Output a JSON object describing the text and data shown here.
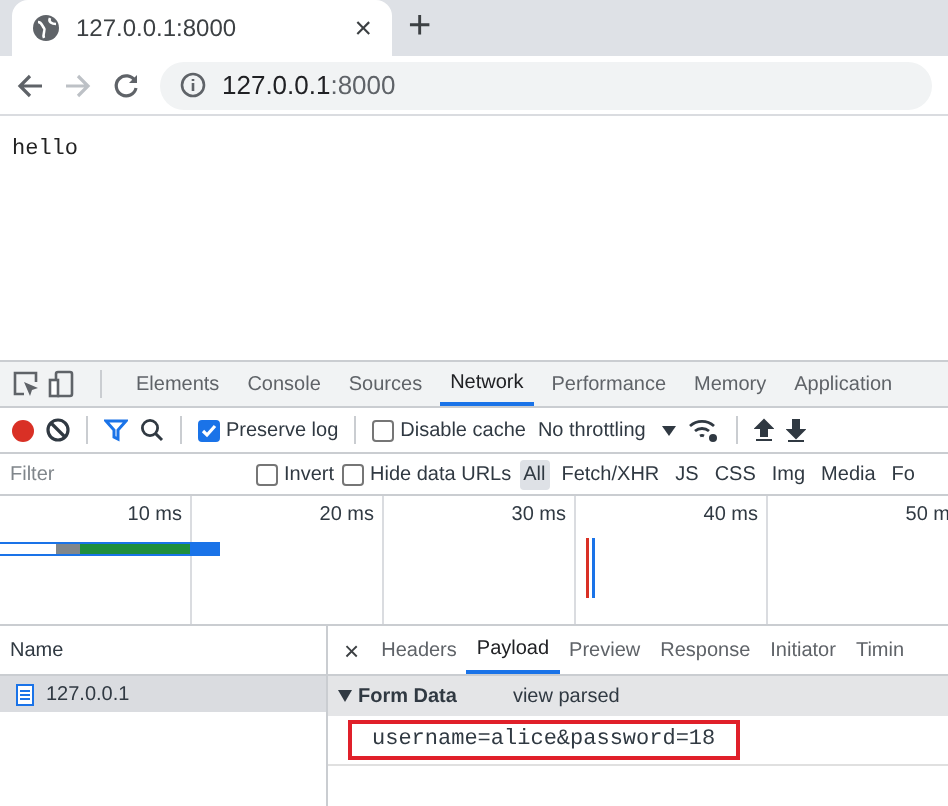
{
  "browser_tab": {
    "title": "127.0.0.1:8000",
    "close": "×",
    "new_tab": "+"
  },
  "address_bar": {
    "host": "127.0.0.1",
    "port": ":8000"
  },
  "page": {
    "text": "hello"
  },
  "devtools": {
    "tabs": [
      {
        "label": "Elements",
        "selected": false
      },
      {
        "label": "Console",
        "selected": false
      },
      {
        "label": "Sources",
        "selected": false
      },
      {
        "label": "Network",
        "selected": true
      },
      {
        "label": "Performance",
        "selected": false
      },
      {
        "label": "Memory",
        "selected": false
      },
      {
        "label": "Application",
        "selected": false
      }
    ],
    "toolbar": {
      "recording": true,
      "preserve_log": {
        "label": "Preserve log",
        "checked": true
      },
      "disable_cache": {
        "label": "Disable cache",
        "checked": false
      },
      "throttling": "No throttling"
    },
    "filter": {
      "placeholder": "Filter",
      "invert": {
        "label": "Invert",
        "checked": false
      },
      "hide_data_urls": {
        "label": "Hide data URLs",
        "checked": false
      },
      "types": [
        {
          "label": "All",
          "selected": true
        },
        {
          "label": "Fetch/XHR",
          "selected": false
        },
        {
          "label": "JS",
          "selected": false
        },
        {
          "label": "CSS",
          "selected": false
        },
        {
          "label": "Img",
          "selected": false
        },
        {
          "label": "Media",
          "selected": false
        },
        {
          "label": "Fo",
          "selected": false
        }
      ]
    },
    "timeline": {
      "ticks": [
        "10 ms",
        "20 ms",
        "30 ms",
        "40 ms",
        "50 m"
      ]
    },
    "requests": {
      "header": "Name",
      "rows": [
        {
          "name": "127.0.0.1",
          "selected": true
        }
      ]
    },
    "detail": {
      "close": "×",
      "tabs": [
        {
          "label": "Headers",
          "selected": false
        },
        {
          "label": "Payload",
          "selected": true
        },
        {
          "label": "Preview",
          "selected": false
        },
        {
          "label": "Response",
          "selected": false
        },
        {
          "label": "Initiator",
          "selected": false
        },
        {
          "label": "Timin",
          "selected": false
        }
      ],
      "section": {
        "title": "Form Data",
        "expanded": true,
        "action": "view parsed",
        "body": "username=alice&password=18",
        "highlighted": true
      }
    }
  }
}
